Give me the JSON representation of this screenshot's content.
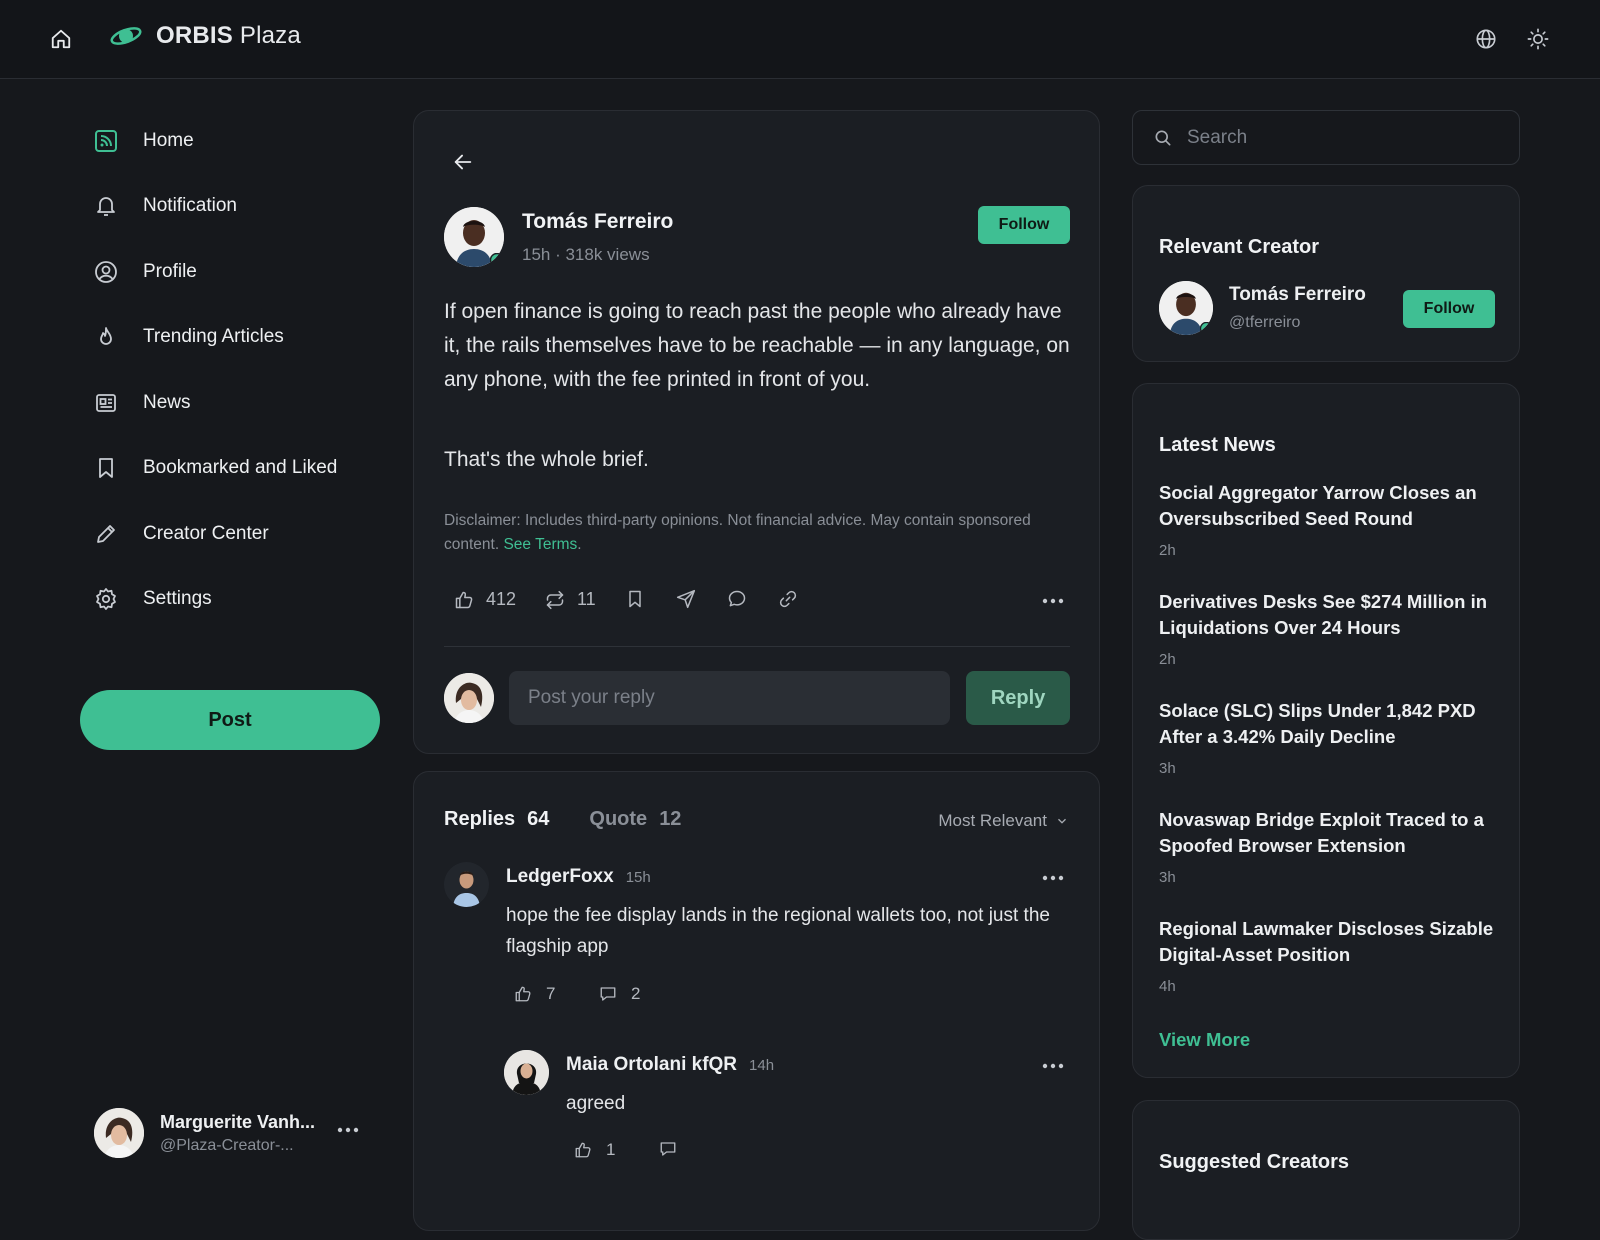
{
  "header": {
    "brand_bold": "ORBIS",
    "brand_light": "Plaza",
    "icons": [
      "home-icon",
      "planet-logo-icon",
      "globe-icon",
      "sun-icon"
    ]
  },
  "sidebar": {
    "items": [
      {
        "label": "Home",
        "icon": "feed-icon",
        "active": true
      },
      {
        "label": "Notification",
        "icon": "bell-icon"
      },
      {
        "label": "Profile",
        "icon": "user-circle-icon"
      },
      {
        "label": "Trending Articles",
        "icon": "flame-icon"
      },
      {
        "label": "News",
        "icon": "newspaper-icon"
      },
      {
        "label": "Bookmarked and Liked",
        "icon": "bookmark-icon"
      },
      {
        "label": "Creator Center",
        "icon": "pencil-icon"
      },
      {
        "label": "Settings",
        "icon": "gear-icon"
      }
    ],
    "post_label": "Post",
    "account": {
      "name": "Marguerite Vanh...",
      "handle": "@Plaza-Creator-..."
    }
  },
  "post": {
    "author": "Tomás Ferreiro",
    "meta": "15h · 318k views",
    "follow_label": "Follow",
    "body_1": "If open finance is going to reach past the people who already have it, the rails themselves have to be reachable — in any language, on any phone, with the fee printed in front of you.",
    "body_2": "That's the whole brief.",
    "disclaimer": "Disclaimer: Includes third-party opinions. Not financial advice. May contain sponsored content.",
    "disclaimer_link": "See Terms",
    "likes": "412",
    "reposts": "11",
    "reply_placeholder": "Post your reply",
    "reply_label": "Reply"
  },
  "replies": {
    "tab_replies": "Replies",
    "replies_count": "64",
    "tab_quote": "Quote",
    "quote_count": "12",
    "sort_label": "Most Relevant",
    "items": [
      {
        "name": "LedgerFoxx",
        "time": "15h",
        "text": "hope the fee display lands in the regional wallets too, not just the flagship app",
        "likes": "7",
        "comments": "2"
      },
      {
        "name": "Maia Ortolani kfQR",
        "time": "14h",
        "text": "agreed",
        "likes": "1",
        "comments": ""
      }
    ]
  },
  "right": {
    "search_placeholder": "Search",
    "relevant_title": "Relevant Creator",
    "relevant": {
      "name": "Tomás Ferreiro",
      "handle": "@tferreiro",
      "follow_label": "Follow"
    },
    "news_title": "Latest News",
    "news": [
      {
        "title": "Social Aggregator Yarrow Closes an Oversubscribed Seed Round",
        "age": "2h"
      },
      {
        "title": "Derivatives Desks See $274 Million in Liquidations Over 24 Hours",
        "age": "2h"
      },
      {
        "title": "Solace (SLC) Slips Under 1,842 PXD After a 3.42% Daily Decline",
        "age": "3h"
      },
      {
        "title": "Novaswap Bridge Exploit Traced to a Spoofed Browser Extension",
        "age": "3h"
      },
      {
        "title": "Regional Lawmaker Discloses Sizable Digital-Asset Position",
        "age": "4h"
      }
    ],
    "view_more": "View More",
    "suggested_title": "Suggested Creators"
  },
  "colors": {
    "accent": "#3fbf93",
    "background": "#16181c",
    "card": "#1b1e23"
  }
}
